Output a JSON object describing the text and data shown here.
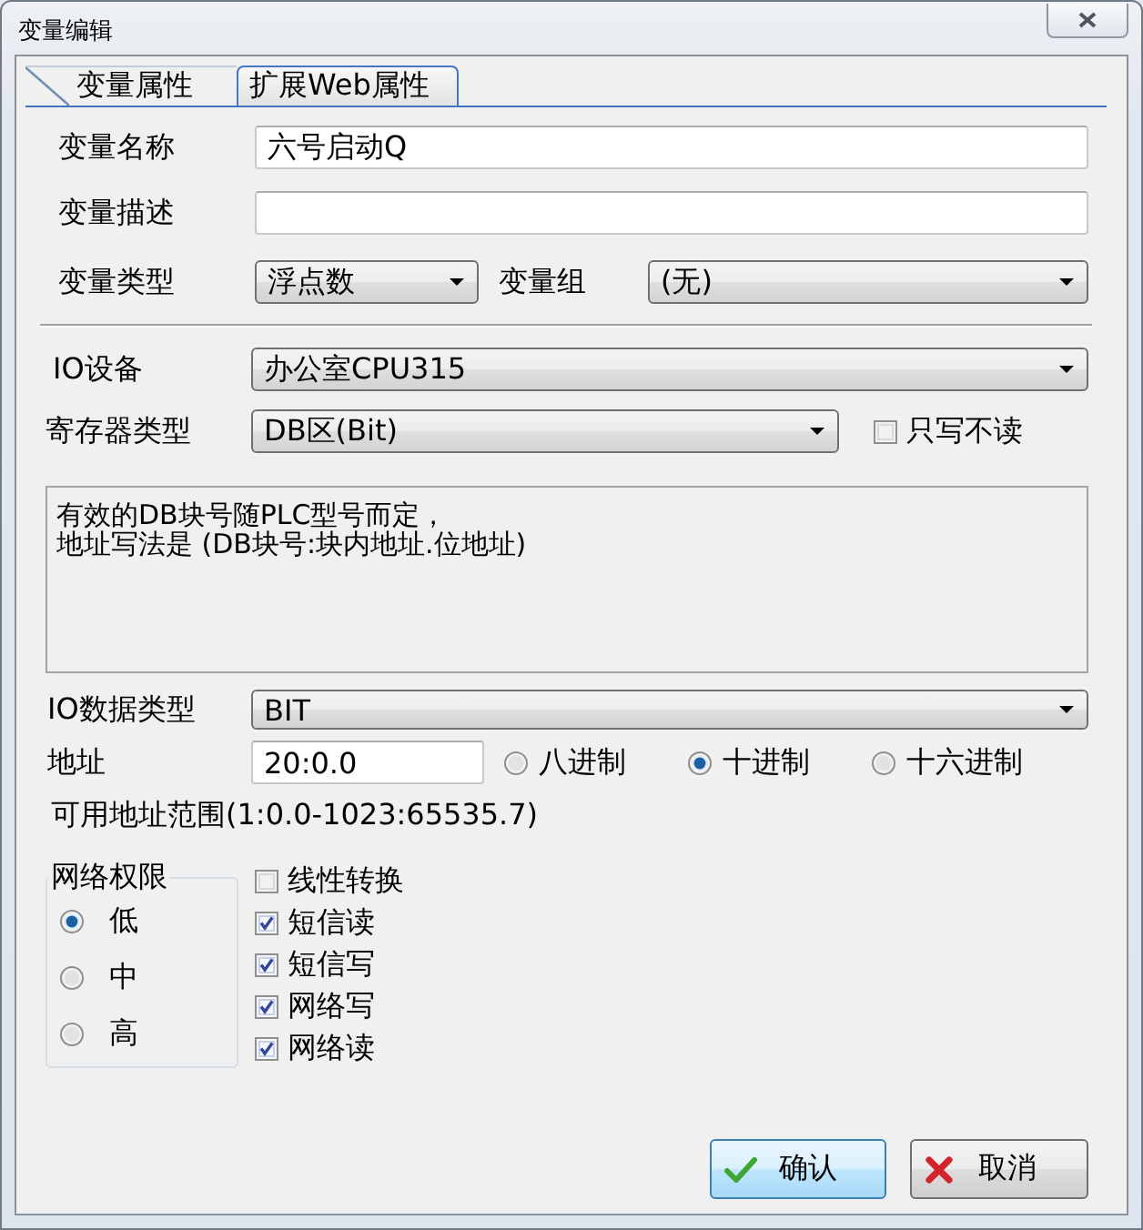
{
  "window": {
    "title": "变量编辑"
  },
  "tabs": [
    {
      "label": "变量属性",
      "selected": true
    },
    {
      "label": "扩展Web属性",
      "selected": false
    }
  ],
  "name": {
    "label": "变量名称",
    "value": "六号启动Q"
  },
  "description": {
    "label": "变量描述"
  },
  "variable_type": {
    "label": "变量类型",
    "value": "浮点数"
  },
  "variable_group": {
    "label": "变量组",
    "value": "(无)"
  },
  "io_device": {
    "label": "IO设备",
    "value": "办公室CPU315"
  },
  "register_type": {
    "label": "寄存器类型",
    "value": "DB区(Bit)"
  },
  "write_only": {
    "label": "只写不读",
    "checked": false
  },
  "hint": {
    "lines": [
      "有效的DB块号随PLC型号而定，",
      "地址写法是 (DB块号:块内地址.位地址)"
    ]
  },
  "io_data_type": {
    "label": "IO数据类型",
    "value": "BIT"
  },
  "address": {
    "label": "地址",
    "value": "20:0.0"
  },
  "radix": [
    {
      "label": "八进制",
      "selected": false
    },
    {
      "label": "十进制",
      "selected": true
    },
    {
      "label": "十六进制",
      "selected": false
    }
  ],
  "address_range": "可用地址范围(1:0.0-1023:65535.7)",
  "network_permission": {
    "title": "网络权限",
    "levels": [
      {
        "label": "低",
        "selected": true
      },
      {
        "label": "中",
        "selected": false
      },
      {
        "label": "高",
        "selected": false
      }
    ]
  },
  "options": [
    {
      "label": "线性转换",
      "checked": false
    },
    {
      "label": "短信读",
      "checked": true
    },
    {
      "label": "短信写",
      "checked": true
    },
    {
      "label": "网络写",
      "checked": true
    },
    {
      "label": "网络读",
      "checked": true
    }
  ],
  "buttons": [
    {
      "label": "确认",
      "kind": "confirm"
    },
    {
      "label": "取消",
      "kind": "cancel"
    }
  ]
}
